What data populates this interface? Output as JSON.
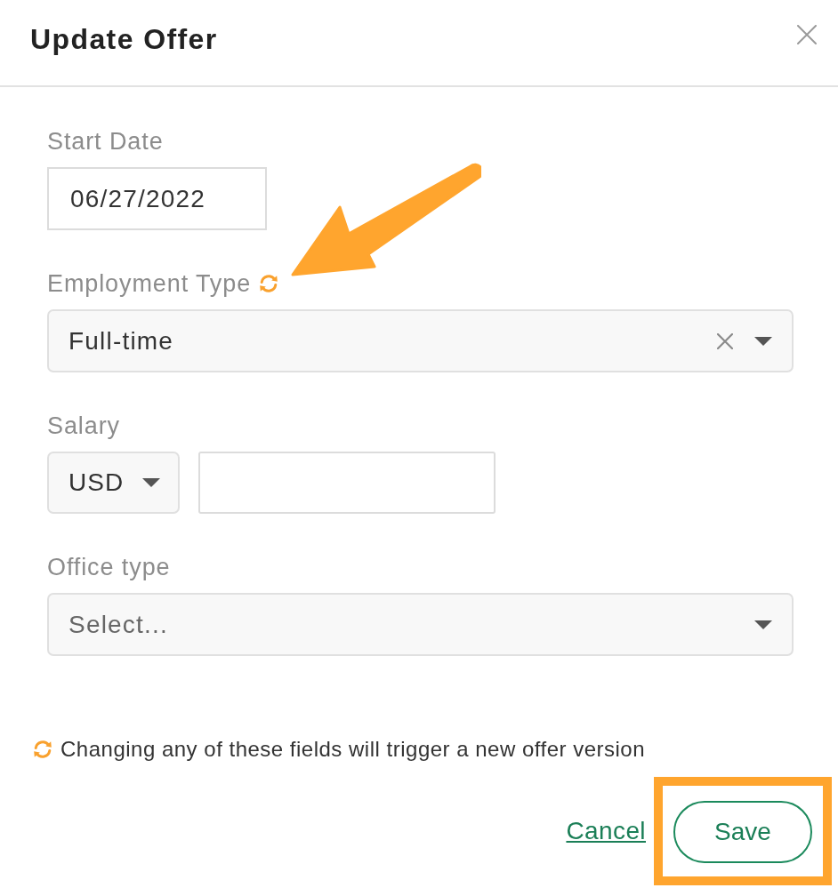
{
  "dialog": {
    "title": "Update Offer"
  },
  "fields": [
    {
      "kind": "date",
      "label": "Start Date",
      "value": "06/27/2022",
      "triggers_new_version": false,
      "annotated": false
    },
    {
      "kind": "select",
      "label": "Employment Type",
      "value": "Full-time",
      "clearable": true,
      "triggers_new_version": true,
      "annotated": true
    },
    {
      "kind": "money",
      "label": "Salary",
      "currency": "USD",
      "triggers_new_version": false,
      "annotated": false
    },
    {
      "kind": "select",
      "label": "Office type",
      "placeholder": "Select...",
      "clearable": false,
      "triggers_new_version": false,
      "annotated": false
    }
  ],
  "note": {
    "text": "Changing any of these fields will trigger a new offer version"
  },
  "actions": [
    {
      "kind": "link",
      "label": "Cancel",
      "highlighted": false
    },
    {
      "kind": "button",
      "label": "Save",
      "highlighted": true
    }
  ]
}
